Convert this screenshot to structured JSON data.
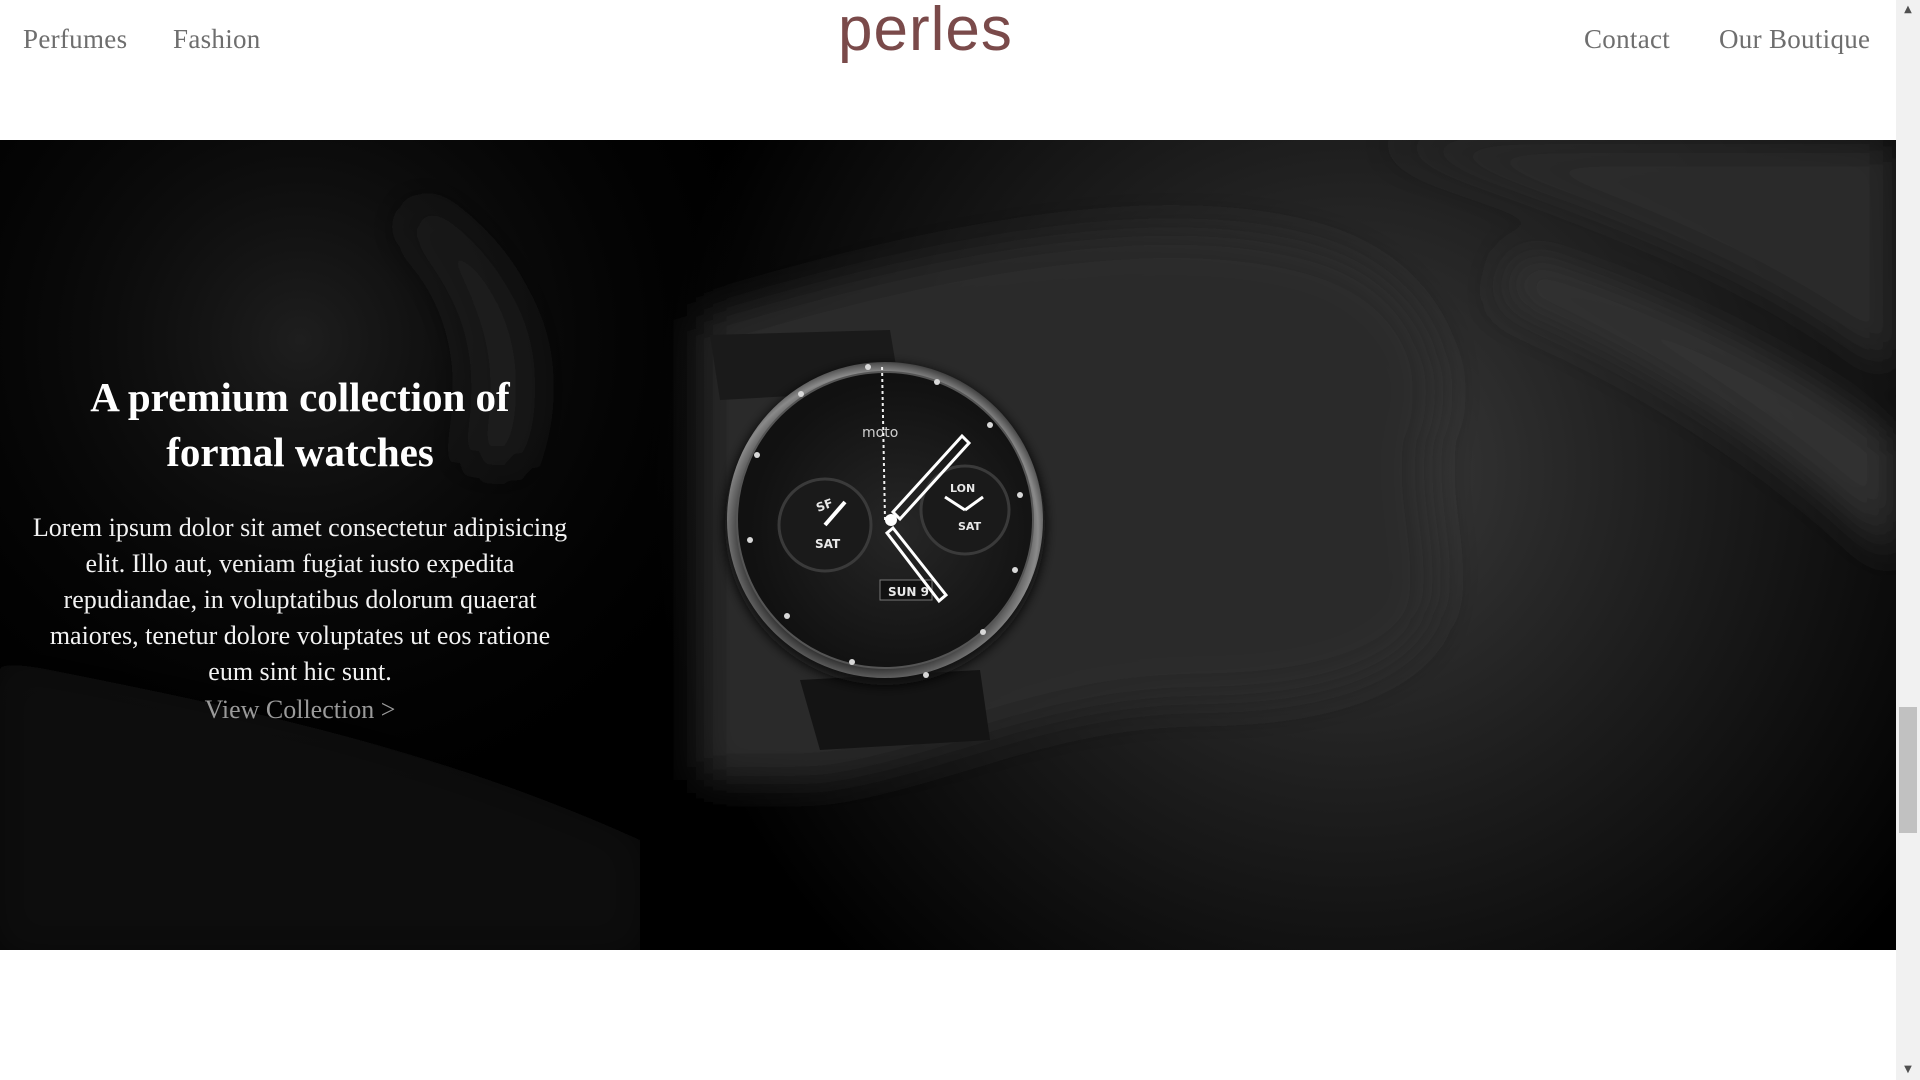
{
  "header": {
    "logo": "perles",
    "nav_left": [
      "Perfumes",
      "Fashion"
    ],
    "nav_right": [
      "Contact",
      "Our Boutique"
    ]
  },
  "hero": {
    "title": "A premium collection of formal watches",
    "body": "Lorem ipsum dolor sit amet consectetur adipisicing elit. Illo aut, veniam fugiat iusto expedita repudiandae, in voluptatibus dolorum quaerat maiores, tenetur dolore voluptates ut eos ratione eum sint hic sunt.",
    "link": "View Collection >",
    "watch": {
      "brand": "moto",
      "left_subdial": [
        "SF",
        "SAT"
      ],
      "right_subdial": [
        "LON",
        "SAT"
      ],
      "date": "SUN 9"
    }
  },
  "scrollbar": {
    "up_icon": "triangle-up-icon",
    "down_icon": "triangle-down-icon"
  },
  "colors": {
    "logo": "#7a4a4a",
    "nav_text": "#6e6e6e",
    "hero_bg": "#000000",
    "hero_text": "#ffffff",
    "link_text": "#9a9a9a"
  }
}
